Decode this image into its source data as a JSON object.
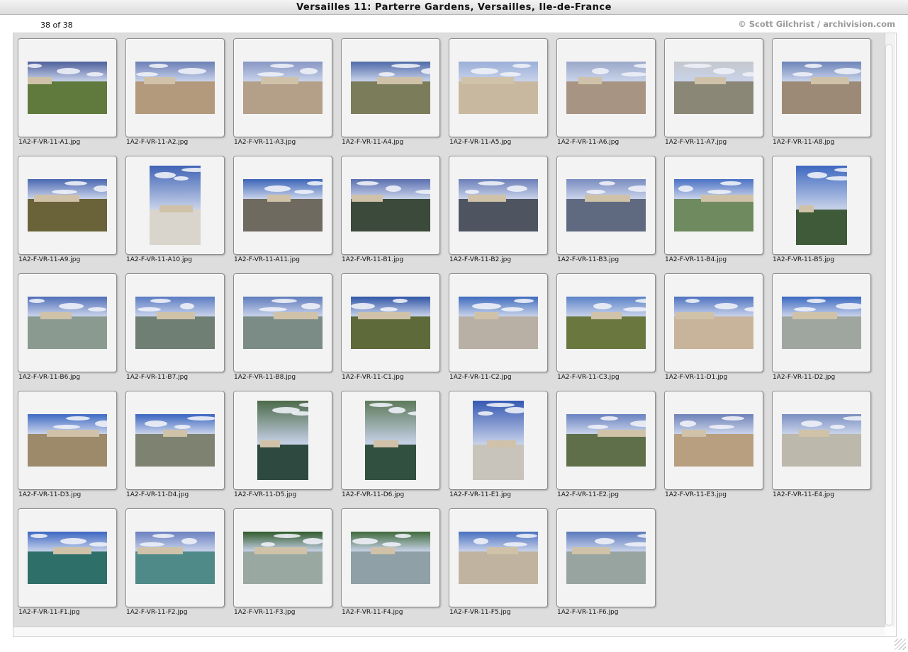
{
  "window": {
    "title": "Versailles 11: Parterre Gardens, Versailles, Ile-de-France"
  },
  "info": {
    "count": "38 of 38",
    "copyright": "© Scott Gilchrist / archivision.com"
  },
  "thumbnails": [
    {
      "filename": "1A2-F-VR-11-A1.jpg",
      "orientation": "landscape",
      "sky": "#4d5f9c",
      "ground": "#5f7a3c"
    },
    {
      "filename": "1A2-F-VR-11-A2.jpg",
      "orientation": "landscape",
      "sky": "#6a7fb5",
      "ground": "#b39a7c"
    },
    {
      "filename": "1A2-F-VR-11-A3.jpg",
      "orientation": "landscape",
      "sky": "#8796c4",
      "ground": "#b4a088"
    },
    {
      "filename": "1A2-F-VR-11-A4.jpg",
      "orientation": "landscape",
      "sky": "#4e6aa8",
      "ground": "#7b7d5a"
    },
    {
      "filename": "1A2-F-VR-11-A5.jpg",
      "orientation": "landscape",
      "sky": "#9aaed8",
      "ground": "#c9b8a0"
    },
    {
      "filename": "1A2-F-VR-11-A6.jpg",
      "orientation": "landscape",
      "sky": "#9aa8c8",
      "ground": "#a89482"
    },
    {
      "filename": "1A2-F-VR-11-A7.jpg",
      "orientation": "landscape",
      "sky": "#c4c7cc",
      "ground": "#8a8776"
    },
    {
      "filename": "1A2-F-VR-11-A8.jpg",
      "orientation": "landscape",
      "sky": "#6d84b8",
      "ground": "#9d8a76"
    },
    {
      "filename": "1A2-F-VR-11-A9.jpg",
      "orientation": "landscape",
      "sky": "#4a68b0",
      "ground": "#6a6238"
    },
    {
      "filename": "1A2-F-VR-11-A10.jpg",
      "orientation": "portrait",
      "sky": "#3f63b5",
      "ground": "#d9d4cc"
    },
    {
      "filename": "1A2-F-VR-11-A11.jpg",
      "orientation": "landscape",
      "sky": "#3b64b8",
      "ground": "#6f6a60"
    },
    {
      "filename": "1A2-F-VR-11-B1.jpg",
      "orientation": "landscape",
      "sky": "#5a6fb0",
      "ground": "#3b4a3a"
    },
    {
      "filename": "1A2-F-VR-11-B2.jpg",
      "orientation": "landscape",
      "sky": "#6c7fb8",
      "ground": "#4e5560"
    },
    {
      "filename": "1A2-F-VR-11-B3.jpg",
      "orientation": "landscape",
      "sky": "#7a8cc0",
      "ground": "#5f6a80"
    },
    {
      "filename": "1A2-F-VR-11-B4.jpg",
      "orientation": "landscape",
      "sky": "#4a72c4",
      "ground": "#6e8a5e"
    },
    {
      "filename": "1A2-F-VR-11-B5.jpg",
      "orientation": "portrait",
      "sky": "#3d68c0",
      "ground": "#3f5a38"
    },
    {
      "filename": "1A2-F-VR-11-B6.jpg",
      "orientation": "landscape",
      "sky": "#4f6eb8",
      "ground": "#8a9a90"
    },
    {
      "filename": "1A2-F-VR-11-B7.jpg",
      "orientation": "landscape",
      "sky": "#5a7bc2",
      "ground": "#6f7f74"
    },
    {
      "filename": "1A2-F-VR-11-B8.jpg",
      "orientation": "landscape",
      "sky": "#5f7cbc",
      "ground": "#7b8c86"
    },
    {
      "filename": "1A2-F-VR-11-C1.jpg",
      "orientation": "landscape",
      "sky": "#2f55a6",
      "ground": "#5e6a3a"
    },
    {
      "filename": "1A2-F-VR-11-C2.jpg",
      "orientation": "landscape",
      "sky": "#3e6bbd",
      "ground": "#b8b0a4"
    },
    {
      "filename": "1A2-F-VR-11-C3.jpg",
      "orientation": "landscape",
      "sky": "#5a82c8",
      "ground": "#6a7840"
    },
    {
      "filename": "1A2-F-VR-11-D1.jpg",
      "orientation": "landscape",
      "sky": "#4d72c0",
      "ground": "#c8b49a"
    },
    {
      "filename": "1A2-F-VR-11-D2.jpg",
      "orientation": "landscape",
      "sky": "#3a68c0",
      "ground": "#9fa6a0"
    },
    {
      "filename": "1A2-F-VR-11-D3.jpg",
      "orientation": "landscape",
      "sky": "#3f6bc4",
      "ground": "#9c8a6a"
    },
    {
      "filename": "1A2-F-VR-11-D4.jpg",
      "orientation": "landscape",
      "sky": "#3a66c0",
      "ground": "#7e8270"
    },
    {
      "filename": "1A2-F-VR-11-D5.jpg",
      "orientation": "portrait",
      "sky": "#4c6a4a",
      "ground": "#2e4a40"
    },
    {
      "filename": "1A2-F-VR-11-D6.jpg",
      "orientation": "portrait",
      "sky": "#5d7a5a",
      "ground": "#32503f"
    },
    {
      "filename": "1A2-F-VR-11-E1.jpg",
      "orientation": "portrait",
      "sky": "#3558b2",
      "ground": "#c8c4bc"
    },
    {
      "filename": "1A2-F-VR-11-E2.jpg",
      "orientation": "landscape",
      "sky": "#6a82c0",
      "ground": "#5e6f4a"
    },
    {
      "filename": "1A2-F-VR-11-E3.jpg",
      "orientation": "landscape",
      "sky": "#6f82b8",
      "ground": "#b89f80"
    },
    {
      "filename": "1A2-F-VR-11-E4.jpg",
      "orientation": "landscape",
      "sky": "#7a8ec0",
      "ground": "#bdb8ac"
    },
    {
      "filename": "1A2-F-VR-11-F1.jpg",
      "orientation": "landscape",
      "sky": "#3a66c2",
      "ground": "#2f6f6a"
    },
    {
      "filename": "1A2-F-VR-11-F2.jpg",
      "orientation": "landscape",
      "sky": "#6a80c0",
      "ground": "#4f8a88"
    },
    {
      "filename": "1A2-F-VR-11-F3.jpg",
      "orientation": "landscape",
      "sky": "#2f5a2a",
      "ground": "#9aa8a2"
    },
    {
      "filename": "1A2-F-VR-11-F4.jpg",
      "orientation": "landscape",
      "sky": "#3e6a3a",
      "ground": "#8fa0a6"
    },
    {
      "filename": "1A2-F-VR-11-F5.jpg",
      "orientation": "landscape",
      "sky": "#4a70c0",
      "ground": "#c0b4a0"
    },
    {
      "filename": "1A2-F-VR-11-F6.jpg",
      "orientation": "landscape",
      "sky": "#5a78bc",
      "ground": "#98a4a0"
    }
  ]
}
